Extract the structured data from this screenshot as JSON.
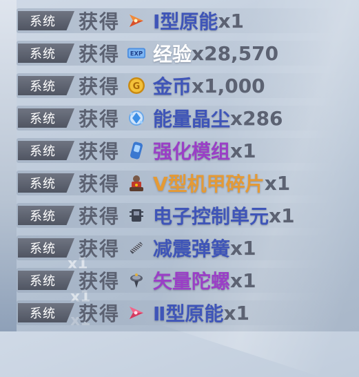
{
  "log": {
    "entries": [
      {
        "tag": "系统",
        "verb": "获得",
        "icon": "energy-core-icon",
        "item": "Ⅰ型原能",
        "qty": "x1",
        "color": "#3f55b8"
      },
      {
        "tag": "系统",
        "verb": "获得",
        "icon": "exp-icon",
        "item": "经验",
        "qty": "x28,570",
        "color": "#ffffff"
      },
      {
        "tag": "系统",
        "verb": "获得",
        "icon": "gold-coin-icon",
        "item": "金币",
        "qty": "x1,000",
        "color": "#3f55b8"
      },
      {
        "tag": "系统",
        "verb": "获得",
        "icon": "crystal-dust-icon",
        "item": "能量晶尘",
        "qty": "x286",
        "color": "#3f55b8"
      },
      {
        "tag": "系统",
        "verb": "获得",
        "icon": "module-icon",
        "item": "强化模组",
        "qty": "x1",
        "color": "#9a3fc6"
      },
      {
        "tag": "系统",
        "verb": "获得",
        "icon": "mech-fragment-icon",
        "item": "V型机甲碎片",
        "qty": "x1",
        "color": "#e49a36"
      },
      {
        "tag": "系统",
        "verb": "获得",
        "icon": "control-unit-icon",
        "item": "电子控制单元",
        "qty": "x1",
        "color": "#3f55b8"
      },
      {
        "tag": "系统",
        "verb": "获得",
        "icon": "spring-icon",
        "item": "减震弹簧",
        "qty": "x1",
        "color": "#3f55b8"
      },
      {
        "tag": "系统",
        "verb": "获得",
        "icon": "gyroscope-icon",
        "item": "矢量陀螺",
        "qty": "x1",
        "color": "#9a3fc6"
      },
      {
        "tag": "系统",
        "verb": "获得",
        "icon": "energy-core-icon",
        "item": "Ⅱ型原能",
        "qty": "x1",
        "color": "#3f55b8"
      }
    ],
    "ghost_text": [
      "x1",
      "x1",
      "x1"
    ]
  }
}
